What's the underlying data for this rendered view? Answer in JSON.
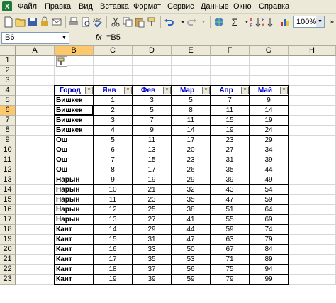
{
  "menu": [
    "Файл",
    "Правка",
    "Вид",
    "Вставка",
    "Формат",
    "Сервис",
    "Данные",
    "Окно",
    "Справка"
  ],
  "toolbar": {
    "zoom": "100%",
    "icons": [
      "new-icon",
      "open-icon",
      "save-icon",
      "permission-icon",
      "email-icon",
      "print-icon",
      "print-preview-icon",
      "spelling-icon",
      "cut-icon",
      "copy-icon",
      "paste-icon",
      "format-painter-icon",
      "undo-icon",
      "redo-icon",
      "hyperlink-icon",
      "autosum-icon",
      "sort-ascending-icon",
      "sort-descending-icon",
      "chart-wizard-icon"
    ]
  },
  "formula_bar": {
    "name_box": "B6",
    "fx": "fx",
    "formula": "=B5"
  },
  "columns": [
    "A",
    "B",
    "C",
    "D",
    "E",
    "F",
    "G",
    "H"
  ],
  "rows": [
    "1",
    "2",
    "3",
    "4",
    "5",
    "6",
    "7",
    "8",
    "9",
    "10",
    "11",
    "12",
    "13",
    "14",
    "15",
    "16",
    "17",
    "18",
    "19",
    "20",
    "21",
    "22",
    "23"
  ],
  "selection": {
    "cell": "B6",
    "column": "B",
    "row": "6"
  },
  "table": {
    "headers": [
      "Город",
      "Янв",
      "Фев",
      "Мар",
      "Апр",
      "Май"
    ],
    "rows": [
      [
        "Бишкек",
        "1",
        "3",
        "5",
        "7",
        "9"
      ],
      [
        "Бишкек",
        "2",
        "5",
        "8",
        "11",
        "14"
      ],
      [
        "Бишкек",
        "3",
        "7",
        "11",
        "15",
        "19"
      ],
      [
        "Бишкек",
        "4",
        "9",
        "14",
        "19",
        "24"
      ],
      [
        "Ош",
        "5",
        "11",
        "17",
        "23",
        "29"
      ],
      [
        "Ош",
        "6",
        "13",
        "20",
        "27",
        "34"
      ],
      [
        "Ош",
        "7",
        "15",
        "23",
        "31",
        "39"
      ],
      [
        "Ош",
        "8",
        "17",
        "26",
        "35",
        "44"
      ],
      [
        "Нарын",
        "9",
        "19",
        "29",
        "39",
        "49"
      ],
      [
        "Нарын",
        "10",
        "21",
        "32",
        "43",
        "54"
      ],
      [
        "Нарын",
        "11",
        "23",
        "35",
        "47",
        "59"
      ],
      [
        "Нарын",
        "12",
        "25",
        "38",
        "51",
        "64"
      ],
      [
        "Нарын",
        "13",
        "27",
        "41",
        "55",
        "69"
      ],
      [
        "Кант",
        "14",
        "29",
        "44",
        "59",
        "74"
      ],
      [
        "Кант",
        "15",
        "31",
        "47",
        "63",
        "79"
      ],
      [
        "Кант",
        "16",
        "33",
        "50",
        "67",
        "84"
      ],
      [
        "Кант",
        "17",
        "35",
        "53",
        "71",
        "89"
      ],
      [
        "Кант",
        "18",
        "37",
        "56",
        "75",
        "94"
      ],
      [
        "Кант",
        "19",
        "39",
        "59",
        "79",
        "99"
      ]
    ]
  },
  "colors": {
    "header_text": "#0000cc",
    "selection_header": "#fbc86d"
  }
}
